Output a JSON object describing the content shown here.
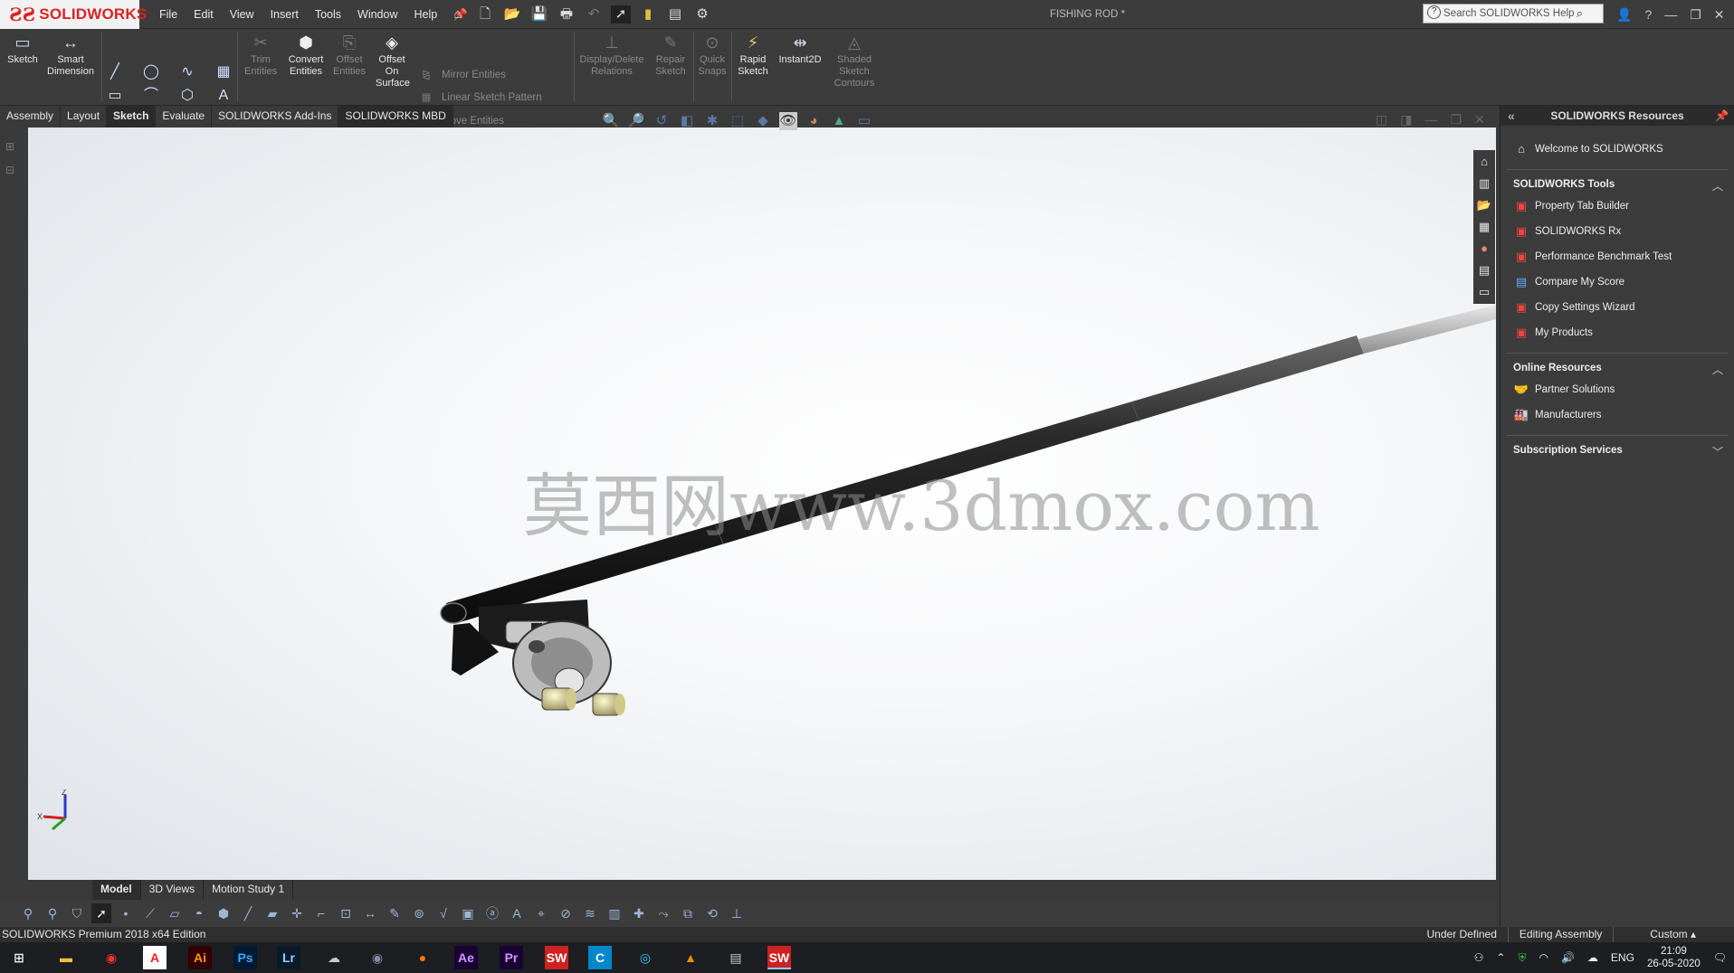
{
  "app": {
    "logo_brand": "SOLIDWORKS",
    "document_title": "FISHING ROD *",
    "search_placeholder": "Search SOLIDWORKS Help"
  },
  "menu": [
    "File",
    "Edit",
    "View",
    "Insert",
    "Tools",
    "Window",
    "Help"
  ],
  "command_manager": {
    "sketch": "Sketch",
    "smart_dimension": "Smart Dimension",
    "trim_entities": "Trim Entities",
    "convert_entities": "Convert Entities",
    "offset_entities": "Offset Entities",
    "offset_on_surface": "Offset On Surface",
    "mirror_entities": "Mirror Entities",
    "linear_sketch_pattern": "Linear Sketch Pattern",
    "move_entities": "Move Entities",
    "display_delete_relations": "Display/Delete Relations",
    "repair_sketch": "Repair Sketch",
    "quick_snaps": "Quick Snaps",
    "rapid_sketch": "Rapid Sketch",
    "instant2d": "Instant2D",
    "shaded_sketch_contours": "Shaded Sketch Contours"
  },
  "tabs": {
    "items": [
      "Assembly",
      "Layout",
      "Sketch",
      "Evaluate",
      "SOLIDWORKS Add-Ins",
      "SOLIDWORKS MBD"
    ],
    "active": "Sketch"
  },
  "watermark": "莫西网www.3dmox.com",
  "triad": {
    "z": "Z",
    "x": "X"
  },
  "bottom_tabs": {
    "items": [
      "Model",
      "3D Views",
      "Motion Study 1"
    ],
    "active": "Model"
  },
  "status_bar": {
    "edition": "SOLIDWORKS Premium 2018 x64 Edition",
    "sketch_state": "Under Defined",
    "mode": "Editing Assembly",
    "units": "Custom"
  },
  "resources_panel": {
    "title": "SOLIDWORKS Resources",
    "welcome": "Welcome to SOLIDWORKS",
    "tools_header": "SOLIDWORKS Tools",
    "tools": [
      "Property Tab Builder",
      "SOLIDWORKS Rx",
      "Performance Benchmark Test",
      "Compare My Score",
      "Copy Settings Wizard",
      "My Products"
    ],
    "online_header": "Online Resources",
    "online": [
      "Partner Solutions",
      "Manufacturers"
    ],
    "subscription_header": "Subscription Services"
  },
  "taskbar": {
    "language": "ENG",
    "time": "21:09",
    "date": "26-05-2020"
  },
  "colors": {
    "solidworks_red": "#d22222",
    "ui_dark": "#3c3c3c",
    "viewport_bg": "#f4f5f7"
  }
}
